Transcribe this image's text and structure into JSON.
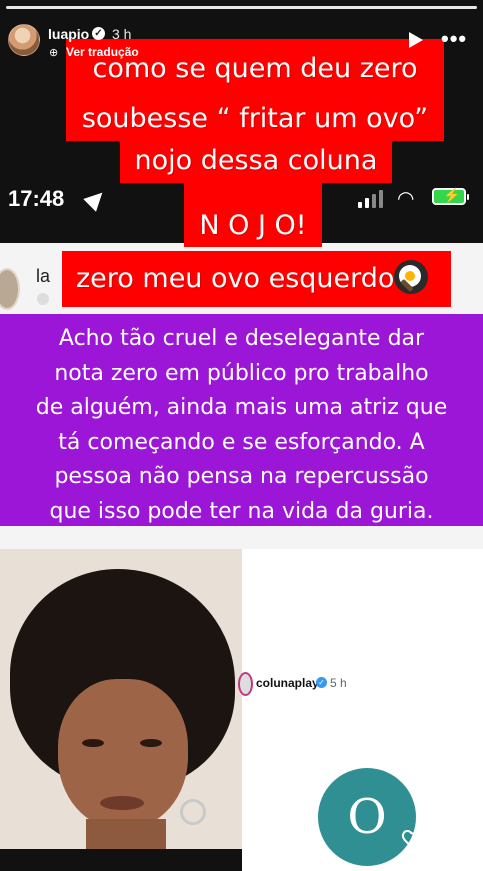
{
  "story": {
    "username": "luapio",
    "time": "3 h",
    "translate_label": "Ver tradução"
  },
  "status_bar": {
    "time": "17:48"
  },
  "post": {
    "author_partial": "la"
  },
  "captions": {
    "red_lines": [
      "como se quem deu zero",
      "soubesse “ fritar um ovo”",
      "nojo dessa coluna",
      "N O J O!"
    ],
    "red_last": "zero meu ovo esquerdo",
    "purple_lines": [
      "Acho tão cruel e deselegante dar",
      "nota zero em público pro trabalho",
      "de alguém, ainda mais uma atriz que",
      "tá começando e se esforçando. A",
      "pessoa não pensa na repercussão",
      "que isso pode ter na vida da guria."
    ]
  },
  "card": {
    "account": "colunaplay",
    "time": "5 h",
    "logo_letter": "O"
  },
  "colors": {
    "caption_red": "#ff0000",
    "caption_purple": "#9b16d6",
    "logo_teal": "#2f8f92"
  }
}
